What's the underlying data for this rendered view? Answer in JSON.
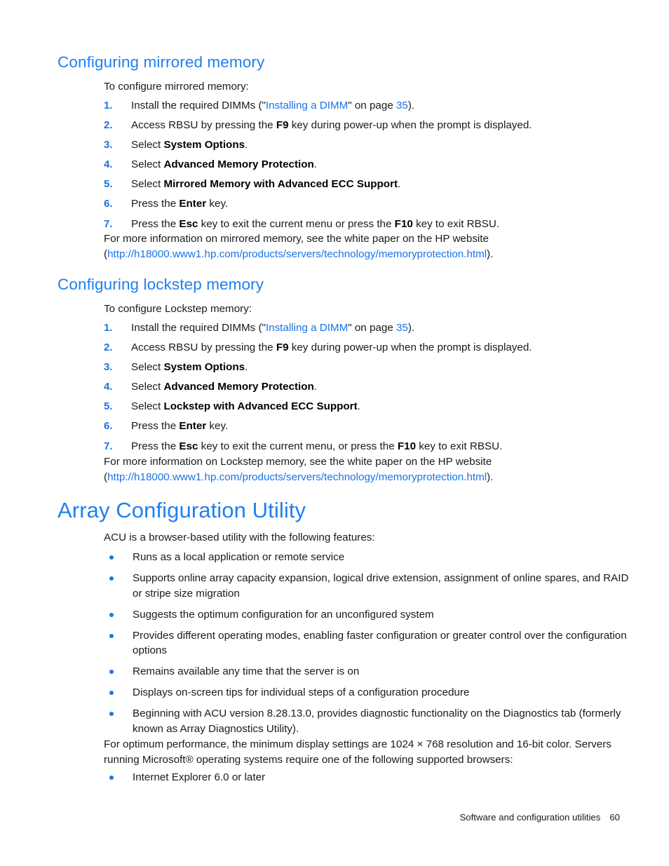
{
  "document": {
    "footer": {
      "section_title": "Software and configuration utilities",
      "page_number": "60"
    }
  },
  "colors": {
    "heading_blue": "#2080f0",
    "link_blue": "#1874e8",
    "body_text": "#1a1a1a",
    "page_background": "#ffffff"
  },
  "sections": [
    {
      "id": "configuring-mirrored-memory",
      "heading": "Configuring mirrored memory",
      "intro": "To configure mirrored memory:",
      "steps": [
        {
          "number": "1.",
          "parts": [
            {
              "t": "Install the required DIMMs (\"",
              "k": "plain"
            },
            {
              "t": "Installing a DIMM",
              "k": "link"
            },
            {
              "t": "\" on page ",
              "k": "plain"
            },
            {
              "t": "35",
              "k": "link"
            },
            {
              "t": ").",
              "k": "plain"
            }
          ]
        },
        {
          "number": "2.",
          "parts": [
            {
              "t": "Access RBSU by pressing the ",
              "k": "plain"
            },
            {
              "t": "F9",
              "k": "bold"
            },
            {
              "t": " key during power-up when the prompt is displayed.",
              "k": "plain"
            }
          ]
        },
        {
          "number": "3.",
          "parts": [
            {
              "t": "Select ",
              "k": "plain"
            },
            {
              "t": "System Options",
              "k": "bold"
            },
            {
              "t": ".",
              "k": "plain"
            }
          ]
        },
        {
          "number": "4.",
          "parts": [
            {
              "t": "Select ",
              "k": "plain"
            },
            {
              "t": "Advanced Memory Protection",
              "k": "bold"
            },
            {
              "t": ".",
              "k": "plain"
            }
          ]
        },
        {
          "number": "5.",
          "parts": [
            {
              "t": "Select ",
              "k": "plain"
            },
            {
              "t": "Mirrored Memory with Advanced ECC Support",
              "k": "bold"
            },
            {
              "t": ".",
              "k": "plain"
            }
          ]
        },
        {
          "number": "6.",
          "parts": [
            {
              "t": "Press the ",
              "k": "plain"
            },
            {
              "t": "Enter",
              "k": "bold"
            },
            {
              "t": " key.",
              "k": "plain"
            }
          ]
        },
        {
          "number": "7.",
          "parts": [
            {
              "t": "Press the ",
              "k": "plain"
            },
            {
              "t": "Esc",
              "k": "bold"
            },
            {
              "t": " key to exit the current menu or press the ",
              "k": "plain"
            },
            {
              "t": "F10",
              "k": "bold"
            },
            {
              "t": " key to exit RBSU.",
              "k": "plain"
            }
          ]
        }
      ],
      "closing": [
        {
          "t": "For more information on mirrored memory, see the white paper on the HP website (",
          "k": "plain"
        },
        {
          "t": "http://h18000.www1.hp.com/products/servers/technology/memoryprotection.html",
          "k": "link"
        },
        {
          "t": ").",
          "k": "plain"
        }
      ]
    },
    {
      "id": "configuring-lockstep-memory",
      "heading": "Configuring lockstep memory",
      "intro": "To configure Lockstep memory:",
      "steps": [
        {
          "number": "1.",
          "parts": [
            {
              "t": "Install the required DIMMs (\"",
              "k": "plain"
            },
            {
              "t": "Installing a DIMM",
              "k": "link"
            },
            {
              "t": "\" on page ",
              "k": "plain"
            },
            {
              "t": "35",
              "k": "link"
            },
            {
              "t": ").",
              "k": "plain"
            }
          ]
        },
        {
          "number": "2.",
          "parts": [
            {
              "t": "Access RBSU by pressing the ",
              "k": "plain"
            },
            {
              "t": "F9",
              "k": "bold"
            },
            {
              "t": " key during power-up when the prompt is displayed.",
              "k": "plain"
            }
          ]
        },
        {
          "number": "3.",
          "parts": [
            {
              "t": "Select ",
              "k": "plain"
            },
            {
              "t": "System Options",
              "k": "bold"
            },
            {
              "t": ".",
              "k": "plain"
            }
          ]
        },
        {
          "number": "4.",
          "parts": [
            {
              "t": "Select ",
              "k": "plain"
            },
            {
              "t": "Advanced Memory Protection",
              "k": "bold"
            },
            {
              "t": ".",
              "k": "plain"
            }
          ]
        },
        {
          "number": "5.",
          "parts": [
            {
              "t": "Select ",
              "k": "plain"
            },
            {
              "t": "Lockstep with Advanced ECC Support",
              "k": "bold"
            },
            {
              "t": ".",
              "k": "plain"
            }
          ]
        },
        {
          "number": "6.",
          "parts": [
            {
              "t": "Press the ",
              "k": "plain"
            },
            {
              "t": "Enter",
              "k": "bold"
            },
            {
              "t": " key.",
              "k": "plain"
            }
          ]
        },
        {
          "number": "7.",
          "parts": [
            {
              "t": "Press the ",
              "k": "plain"
            },
            {
              "t": "Esc",
              "k": "bold"
            },
            {
              "t": " key to exit the current menu, or press the ",
              "k": "plain"
            },
            {
              "t": "F10",
              "k": "bold"
            },
            {
              "t": " key to exit RBSU.",
              "k": "plain"
            }
          ]
        }
      ],
      "closing": [
        {
          "t": "For more information on Lockstep memory, see the white paper on the HP website (",
          "k": "plain"
        },
        {
          "t": "http://h18000.www1.hp.com/products/servers/technology/memoryprotection.html",
          "k": "link"
        },
        {
          "t": ").",
          "k": "plain"
        }
      ]
    }
  ],
  "acu": {
    "heading": "Array Configuration Utility",
    "intro": "ACU is a browser-based utility with the following features:",
    "features": [
      "Runs as a local application or remote service",
      "Supports online array capacity expansion, logical drive extension, assignment of online spares, and RAID or stripe size migration",
      "Suggests the optimum configuration for an unconfigured system",
      "Provides different operating modes, enabling faster configuration or greater control over the configuration options",
      "Remains available any time that the server is on",
      "Displays on-screen tips for individual steps of a configuration procedure",
      "Beginning with ACU version 8.28.13.0, provides diagnostic functionality on the Diagnostics tab (formerly known as Array Diagnostics Utility)."
    ],
    "requirements_paragraph": "For optimum performance, the minimum display settings are 1024 × 768 resolution and 16-bit color. Servers running Microsoft® operating systems require one of the following supported browsers:",
    "browsers": [
      "Internet Explorer 6.0 or later"
    ]
  }
}
